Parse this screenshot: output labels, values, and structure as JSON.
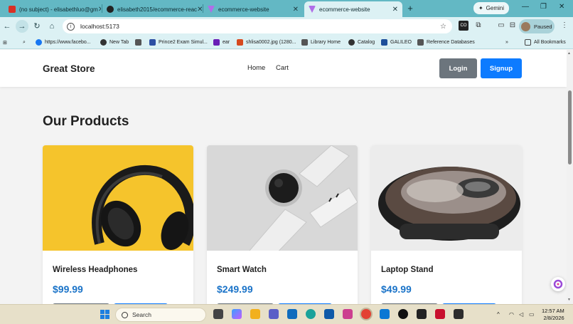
{
  "browser": {
    "tabs": [
      {
        "title": "(no subject) - elisabethluo@gm",
        "color": "#d93025"
      },
      {
        "title": "elisabeth2015/ecommerce-reac",
        "color": "#222222"
      },
      {
        "title": "ecommerce-website",
        "color": "#b06ee8"
      },
      {
        "title": "ecommerce-website",
        "color": "#b06ee8"
      }
    ],
    "gemini_label": "Gemini",
    "address": "localhost:5173",
    "profile_label": "Paused",
    "bookmarks": [
      {
        "label": "https://www.facebo...",
        "color": "#1877f2"
      },
      {
        "label": "New Tab",
        "color": "#333333"
      },
      {
        "label": "Prince2 Exam Simul...",
        "color": "#2d4fa3"
      },
      {
        "label": "ear",
        "color": "#6a1fb6"
      },
      {
        "label": "shlisa0002.jpg (1280...",
        "color": "#d64a1f"
      },
      {
        "label": "Library Home",
        "color": "#555555"
      },
      {
        "label": "Catalog",
        "color": "#333333"
      },
      {
        "label": "GALILEO",
        "color": "#1d4f9a"
      },
      {
        "label": "Reference Databases",
        "color": "#555555"
      }
    ],
    "all_bookmarks_label": "All Bookmarks"
  },
  "site": {
    "brand": "Great Store",
    "nav": {
      "home": "Home",
      "cart": "Cart"
    },
    "login_label": "Login",
    "signup_label": "Signup",
    "section_title": "Our Products",
    "products": [
      {
        "name": "Wireless Headphones",
        "price": "$99.99"
      },
      {
        "name": "Smart Watch",
        "price": "$249.99"
      },
      {
        "name": "Laptop Stand",
        "price": "$49.99"
      }
    ]
  },
  "taskbar": {
    "search_placeholder": "Search",
    "time": "12:57 AM",
    "date": "2/8/2026"
  },
  "colors": {
    "brand_blue": "#0d7bff",
    "secondary_gray": "#6c757d",
    "price_blue": "#1a73c8",
    "chrome_teal": "#63b8c4"
  }
}
